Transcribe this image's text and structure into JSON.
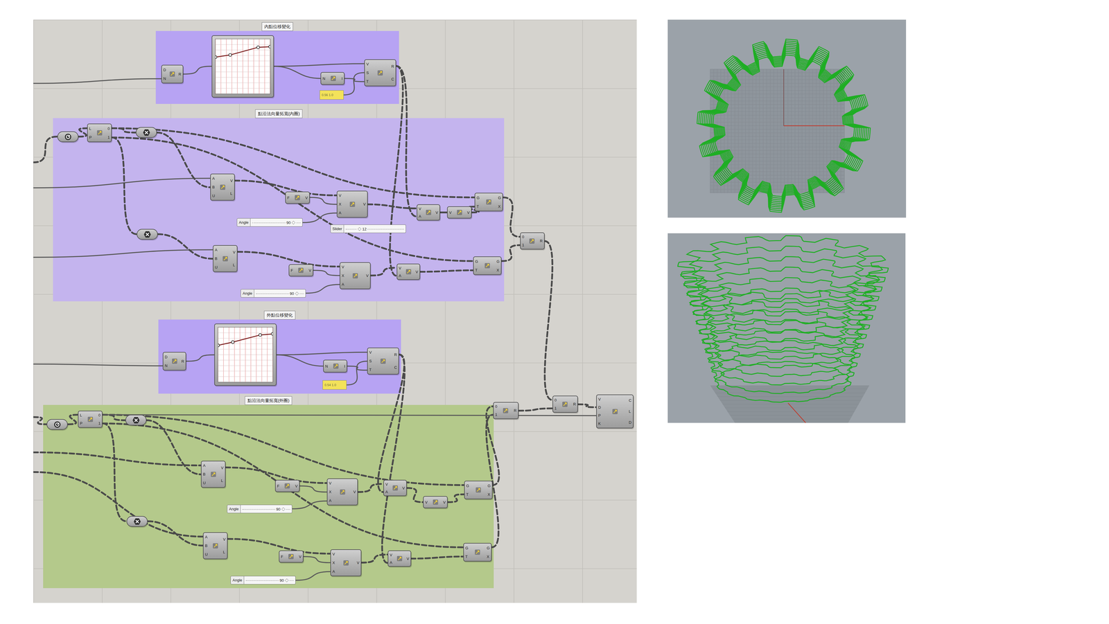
{
  "canvas": {
    "groups": [
      {
        "title": "內點位移變化",
        "color": "#b7a3f3"
      },
      {
        "title": "點沿法向量拓寬(內圈)",
        "color": "#c4b4ee"
      },
      {
        "title": "外點位移變化",
        "color": "#b7a3f3"
      },
      {
        "title": "點沿法向量拓寬(外圈)",
        "color": "#b4c98b"
      }
    ],
    "nodes": [
      {
        "kind": "component",
        "inputs": [
          "D",
          "N"
        ],
        "outputs": [
          "R"
        ]
      },
      {
        "kind": "graph",
        "points": [
          [
            0,
            0.67
          ],
          [
            0.27,
            0.71
          ],
          [
            0.78,
            0.85
          ],
          [
            1,
            0.86
          ]
        ]
      },
      {
        "kind": "component",
        "inputs": [
          "N"
        ],
        "outputs": [
          "I"
        ]
      },
      {
        "kind": "panel",
        "text": "0.56 1.0"
      },
      {
        "kind": "component",
        "inputs": [
          "V",
          "S",
          "T"
        ],
        "outputs": [
          "R",
          "C"
        ]
      },
      {
        "kind": "param"
      },
      {
        "kind": "component",
        "inputs": [
          "L",
          "P"
        ],
        "outputs": [
          "0",
          "1"
        ]
      },
      {
        "kind": "negate"
      },
      {
        "kind": "component",
        "inputs": [
          "A",
          "B",
          "U"
        ],
        "outputs": [
          "V",
          "L"
        ]
      },
      {
        "kind": "component",
        "inputs": [
          "F"
        ],
        "outputs": [
          "V"
        ]
      },
      {
        "kind": "component",
        "inputs": [
          "V",
          "X",
          "A"
        ],
        "outputs": [
          "V"
        ]
      },
      {
        "kind": "slider",
        "label": "Angle",
        "value": "90 ◇",
        "level": 0.85
      },
      {
        "kind": "slider",
        "label": "Slider",
        "value": "◇ 12",
        "level": 0.25
      },
      {
        "kind": "component",
        "inputs": [
          "V",
          "A"
        ],
        "outputs": [
          "V"
        ]
      },
      {
        "kind": "component",
        "inputs": [
          "V"
        ],
        "outputs": [
          "V"
        ]
      },
      {
        "kind": "component",
        "inputs": [
          "G",
          "T"
        ],
        "outputs": [
          "G",
          "X"
        ]
      },
      {
        "kind": "negate"
      },
      {
        "kind": "component",
        "inputs": [
          "A",
          "B",
          "U"
        ],
        "outputs": [
          "V",
          "L"
        ]
      },
      {
        "kind": "component",
        "inputs": [
          "F"
        ],
        "outputs": [
          "V"
        ]
      },
      {
        "kind": "component",
        "inputs": [
          "V",
          "X",
          "A"
        ],
        "outputs": [
          "V"
        ]
      },
      {
        "kind": "slider",
        "label": "Angle",
        "value": "90 ◇",
        "level": 0.85
      },
      {
        "kind": "component",
        "inputs": [
          "V",
          "A"
        ],
        "outputs": [
          "V"
        ]
      },
      {
        "kind": "component",
        "inputs": [
          "G",
          "T"
        ],
        "outputs": [
          "G",
          "X"
        ]
      },
      {
        "kind": "component",
        "inputs": [
          "0",
          "1"
        ],
        "outputs": [
          "R"
        ]
      },
      {
        "kind": "component",
        "inputs": [
          "D",
          "N"
        ],
        "outputs": [
          "R"
        ]
      },
      {
        "kind": "graph",
        "points": [
          [
            0,
            0.67
          ],
          [
            0.27,
            0.73
          ],
          [
            0.77,
            0.86
          ],
          [
            1,
            0.88
          ]
        ]
      },
      {
        "kind": "component",
        "inputs": [
          "N"
        ],
        "outputs": [
          "I"
        ]
      },
      {
        "kind": "panel",
        "text": "0.54 1.0"
      },
      {
        "kind": "component",
        "inputs": [
          "V",
          "S",
          "T"
        ],
        "outputs": [
          "R",
          "C"
        ]
      },
      {
        "kind": "param"
      },
      {
        "kind": "component",
        "inputs": [
          "L",
          "P"
        ],
        "outputs": [
          "0",
          "1"
        ]
      },
      {
        "kind": "negate"
      },
      {
        "kind": "component",
        "inputs": [
          "A",
          "B",
          "U"
        ],
        "outputs": [
          "V",
          "L"
        ]
      },
      {
        "kind": "component",
        "inputs": [
          "F"
        ],
        "outputs": [
          "V"
        ]
      },
      {
        "kind": "component",
        "inputs": [
          "V",
          "X",
          "A"
        ],
        "outputs": [
          "V"
        ]
      },
      {
        "kind": "slider",
        "label": "Angle",
        "value": "90 ◇",
        "level": 0.85
      },
      {
        "kind": "component",
        "inputs": [
          "V",
          "A"
        ],
        "outputs": [
          "V"
        ]
      },
      {
        "kind": "component",
        "inputs": [
          "V"
        ],
        "outputs": [
          "V"
        ]
      },
      {
        "kind": "component",
        "inputs": [
          "G",
          "T"
        ],
        "outputs": [
          "G",
          "X"
        ]
      },
      {
        "kind": "negate"
      },
      {
        "kind": "component",
        "inputs": [
          "A",
          "B",
          "U"
        ],
        "outputs": [
          "V",
          "L"
        ]
      },
      {
        "kind": "component",
        "inputs": [
          "F"
        ],
        "outputs": [
          "V"
        ]
      },
      {
        "kind": "component",
        "inputs": [
          "V",
          "X",
          "A"
        ],
        "outputs": [
          "V"
        ]
      },
      {
        "kind": "slider",
        "label": "Angle",
        "value": "90 ◇",
        "level": 0.85
      },
      {
        "kind": "component",
        "inputs": [
          "V",
          "A"
        ],
        "outputs": [
          "V"
        ]
      },
      {
        "kind": "component",
        "inputs": [
          "G",
          "T"
        ],
        "outputs": [
          "G",
          "X"
        ]
      },
      {
        "kind": "component",
        "inputs": [
          "0",
          "1"
        ],
        "outputs": [
          "R"
        ]
      },
      {
        "kind": "component",
        "inputs": [
          "0",
          "1"
        ],
        "outputs": [
          "R"
        ]
      },
      {
        "kind": "component",
        "inputs": [
          "V",
          "D",
          "P",
          "K"
        ],
        "outputs": [
          "C",
          "L",
          "D"
        ]
      }
    ]
  },
  "viewports": [
    {
      "kind": "top"
    },
    {
      "kind": "perspective"
    }
  ]
}
